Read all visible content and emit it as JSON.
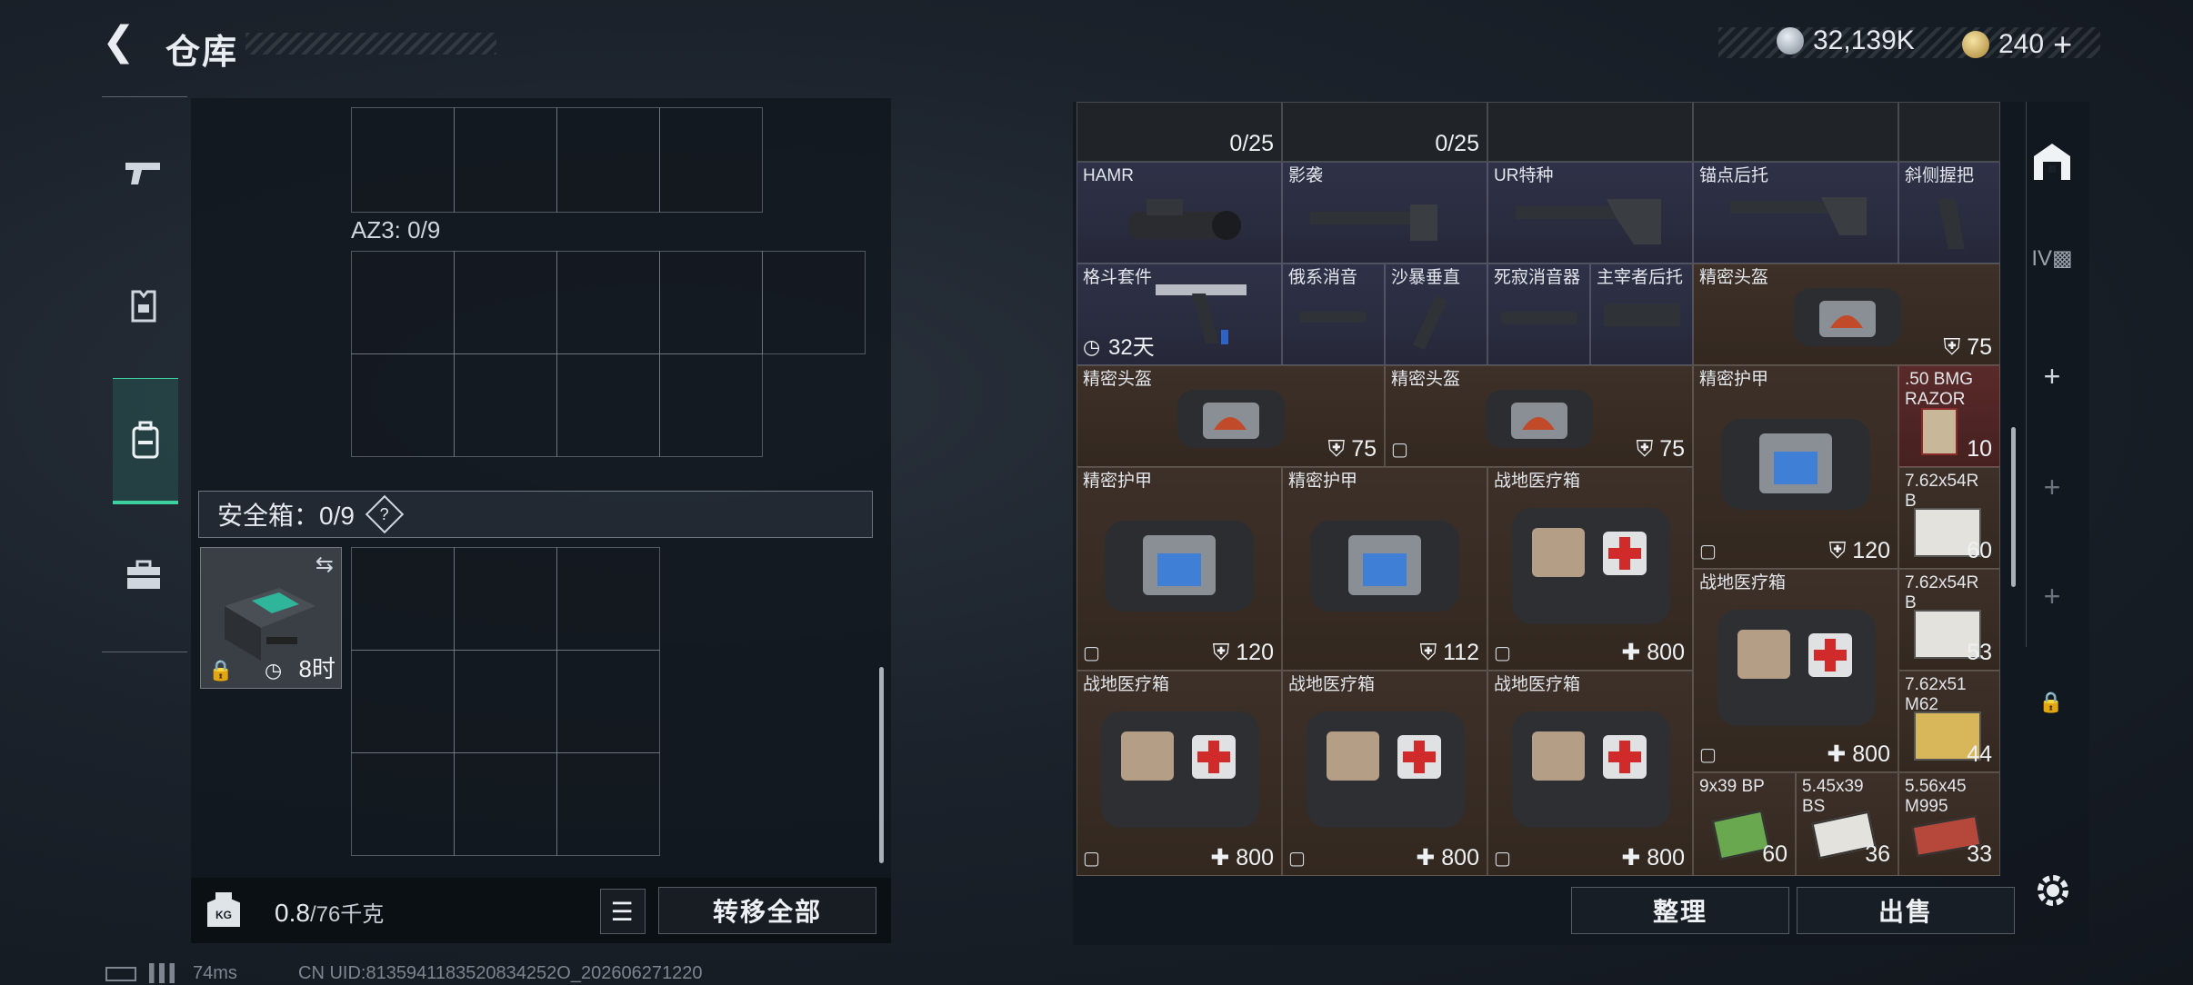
{
  "header": {
    "title": "仓库",
    "back_icon": "chevron-left-icon",
    "currency1": {
      "icon": "silver-coin-icon",
      "value": "32,139K"
    },
    "currency2": {
      "icon": "gold-coin-icon",
      "value": "240",
      "plus": "+"
    }
  },
  "left_tabs": [
    {
      "icon": "pistol-icon"
    },
    {
      "icon": "armor-vest-icon"
    },
    {
      "icon": "backpack-icon",
      "active": true
    },
    {
      "icon": "toolbox-icon"
    }
  ],
  "left_panel": {
    "az3_label": "AZ3: 0/9",
    "safe_box_label": "安全箱：0/9",
    "help_label": "?",
    "safe_box": {
      "time": "8时",
      "lock_icon": "lock-icon",
      "swap_icon": "swap-icon"
    },
    "weight_value": "0.8",
    "weight_unit": "/76千克",
    "kg_icon": "KG",
    "list_icon": "list-icon",
    "transfer_all": "转移全部"
  },
  "right_grid": {
    "items": [
      {
        "id": "r0c0",
        "name": "",
        "value": "0/25",
        "bg": "dark"
      },
      {
        "id": "r0c1",
        "name": "",
        "value": "0/25",
        "bg": "dark"
      },
      {
        "id": "r0c2",
        "name": "",
        "value": "",
        "bg": "dark"
      },
      {
        "id": "r0c3",
        "name": "",
        "value": "",
        "bg": "dark"
      },
      {
        "id": "r0c4",
        "name": "",
        "value": "",
        "bg": "dark"
      },
      {
        "id": "hamr",
        "name": "HAMR",
        "value": "",
        "bg": "blue"
      },
      {
        "id": "yingxi",
        "name": "影袭",
        "value": "",
        "bg": "blue"
      },
      {
        "id": "ur",
        "name": "UR特种",
        "value": "",
        "bg": "blue"
      },
      {
        "id": "maodian",
        "name": "锚点后托",
        "value": "",
        "bg": "blue"
      },
      {
        "id": "xiece",
        "name": "斜侧握把",
        "value": "",
        "bg": "blue"
      },
      {
        "id": "gedou",
        "name": "格斗套件",
        "value": "32天",
        "bg": "blue"
      },
      {
        "id": "ejixi",
        "name": "俄系消音",
        "value": "",
        "bg": "blue"
      },
      {
        "id": "shabao",
        "name": "沙暴垂直",
        "value": "",
        "bg": "blue"
      },
      {
        "id": "sijing",
        "name": "死寂消音器",
        "value": "",
        "bg": "blue"
      },
      {
        "id": "zhuzai",
        "name": "主宰者后托",
        "value": "",
        "bg": "blue"
      },
      {
        "id": "helmet1",
        "name": "精密头盔",
        "value": "75",
        "bg": "brown"
      },
      {
        "id": "helmet2",
        "name": "精密头盔",
        "value": "75",
        "bg": "brown"
      },
      {
        "id": "helmet3",
        "name": "精密头盔",
        "value": "75",
        "bg": "brown"
      },
      {
        "id": "armor1",
        "name": "精密护甲",
        "value": "120",
        "bg": "brown"
      },
      {
        "id": "bmg",
        "name": ".50 BMG RAZOR",
        "value": "10",
        "bg": "red"
      },
      {
        "id": "armor2",
        "name": "精密护甲",
        "value": "120",
        "bg": "brown"
      },
      {
        "id": "armor3",
        "name": "精密护甲",
        "value": "112",
        "bg": "brown"
      },
      {
        "id": "med1",
        "name": "战地医疗箱",
        "value": "800",
        "bg": "brown"
      },
      {
        "id": "r762a",
        "name": "7.62x54R B",
        "value": "60",
        "bg": "brown"
      },
      {
        "id": "med2",
        "name": "战地医疗箱",
        "value": "800",
        "bg": "brown"
      },
      {
        "id": "r762b",
        "name": "7.62x54R B",
        "value": "53",
        "bg": "brown"
      },
      {
        "id": "med3",
        "name": "战地医疗箱",
        "value": "800",
        "bg": "brown"
      },
      {
        "id": "med4",
        "name": "战地医疗箱",
        "value": "800",
        "bg": "brown"
      },
      {
        "id": "med5",
        "name": "战地医疗箱",
        "value": "800",
        "bg": "brown"
      },
      {
        "id": "r762c",
        "name": "7.62x51 M62",
        "value": "44",
        "bg": "brown"
      },
      {
        "id": "r9x39",
        "name": "9x39 BP",
        "value": "60",
        "bg": "brown"
      },
      {
        "id": "r545",
        "name": "5.45x39 BS",
        "value": "36",
        "bg": "brown"
      },
      {
        "id": "r556",
        "name": "5.56x45 M995",
        "value": "33",
        "bg": "brown"
      }
    ],
    "sort_button": "整理",
    "sell_button": "出售"
  },
  "right_side": {
    "icons": [
      "warehouse-icon",
      "storage-iv-icon",
      "plus-icon",
      "plus-icon",
      "plus-icon",
      "lock-icon"
    ],
    "settings_icon": "gear-icon"
  },
  "status_bar": {
    "ping": "74ms",
    "uid": "CN UID:8135941183520834252O_202606271220"
  }
}
